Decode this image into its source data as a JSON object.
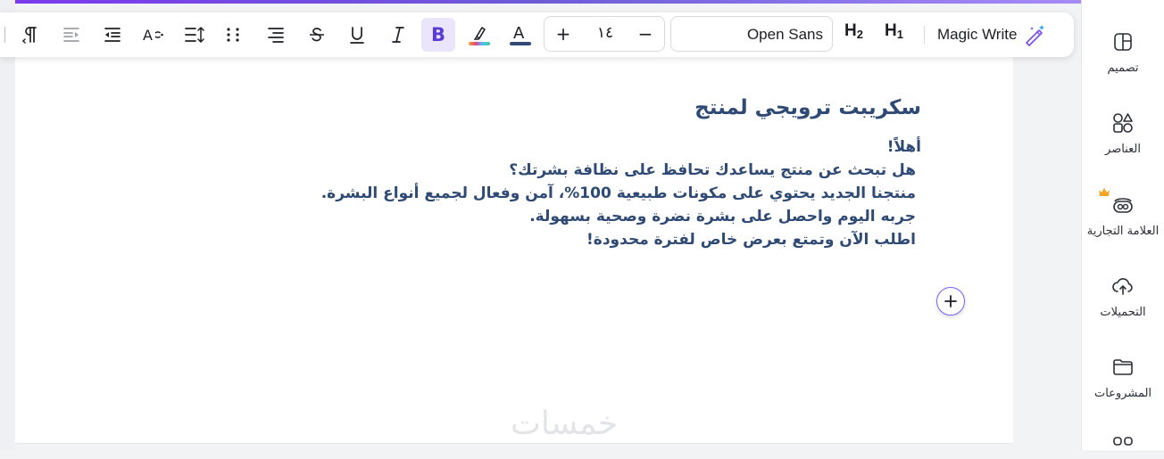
{
  "toolbar": {
    "font_size": "١٤",
    "font_family": "Open Sans",
    "h2_label": "H",
    "h2_sub": "2",
    "h1_label": "H",
    "h1_sub": "1",
    "bold_label": "B",
    "magic_write_label": "Magic Write",
    "plus_label": "+",
    "minus_label": "−",
    "text_color": "#2f4a74",
    "accent_color": "#5b3ad6"
  },
  "sidebar": {
    "items": [
      {
        "label": "تصميم",
        "icon": "layout-icon"
      },
      {
        "label": "العناصر",
        "icon": "elements-icon"
      },
      {
        "label": "العلامة التجارية",
        "icon": "brand-icon"
      },
      {
        "label": "التحميلات",
        "icon": "upload-cloud-icon"
      },
      {
        "label": "المشروعات",
        "icon": "folder-icon"
      },
      {
        "label": "",
        "icon": "apps-icon"
      }
    ]
  },
  "document": {
    "title": "سكريبت ترويجي لمنتج",
    "lines": [
      "أهلاً!",
      "هل تبحث عن منتج يساعدك تحافظ على نظافة بشرتك؟",
      "منتجنا الجديد يحتوي على مكونات طبيعية 100%، آمن وفعال لجميع أنواع البشرة.",
      "جربه اليوم واحصل على بشرة نضرة وصحية بسهولة.",
      "اطلب الآن وتمتع بعرض خاص لفترة محدودة!"
    ]
  },
  "watermark": "خمسات"
}
